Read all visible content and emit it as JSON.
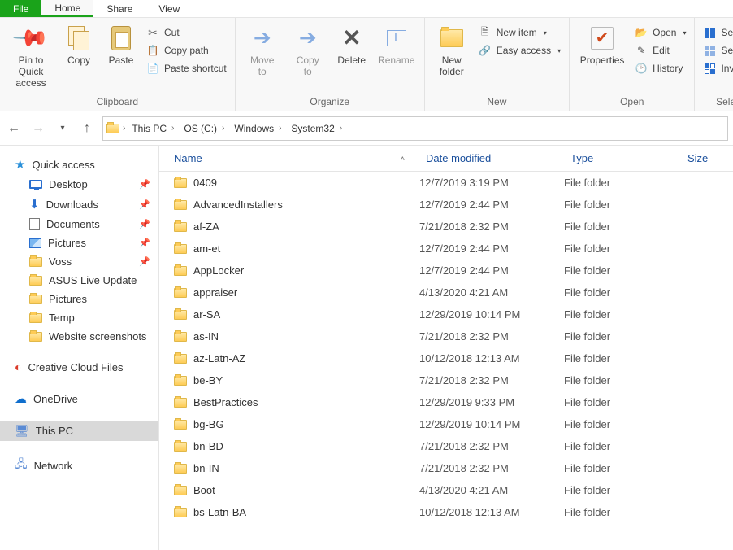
{
  "tabs": {
    "file": "File",
    "home": "Home",
    "share": "Share",
    "view": "View"
  },
  "ribbon": {
    "clipboard": {
      "label": "Clipboard",
      "pin": "Pin to Quick\naccess",
      "copy": "Copy",
      "paste": "Paste",
      "cut": "Cut",
      "copypath": "Copy path",
      "pasteshortcut": "Paste shortcut"
    },
    "organize": {
      "label": "Organize",
      "moveto": "Move\nto",
      "copyto": "Copy\nto",
      "delete": "Delete",
      "rename": "Rename"
    },
    "new": {
      "label": "New",
      "newfolder": "New\nfolder",
      "newitem": "New item",
      "easyaccess": "Easy access"
    },
    "open": {
      "label": "Open",
      "properties": "Properties",
      "open": "Open",
      "edit": "Edit",
      "history": "History"
    },
    "select": {
      "label": "Sele",
      "all": "Select",
      "none": "Select",
      "invert": "Invert"
    }
  },
  "breadcrumbs": [
    "This PC",
    "OS (C:)",
    "Windows",
    "System32"
  ],
  "columns": {
    "name": "Name",
    "date": "Date modified",
    "type": "Type",
    "size": "Size"
  },
  "sidebar": {
    "quick": "Quick access",
    "items": [
      {
        "icon": "monitor",
        "label": "Desktop",
        "pin": true
      },
      {
        "icon": "down",
        "label": "Downloads",
        "pin": true
      },
      {
        "icon": "doc",
        "label": "Documents",
        "pin": true
      },
      {
        "icon": "pic",
        "label": "Pictures",
        "pin": true
      },
      {
        "icon": "folder",
        "label": "Voss",
        "pin": true
      },
      {
        "icon": "folder",
        "label": "ASUS Live Update",
        "pin": false
      },
      {
        "icon": "folder",
        "label": "Pictures",
        "pin": false
      },
      {
        "icon": "folder",
        "label": "Temp",
        "pin": false
      },
      {
        "icon": "folder",
        "label": "Website screenshots",
        "pin": false
      }
    ],
    "creative": "Creative Cloud Files",
    "onedrive": "OneDrive",
    "thispc": "This PC",
    "network": "Network"
  },
  "files": [
    {
      "name": "0409",
      "date": "12/7/2019 3:19 PM",
      "type": "File folder"
    },
    {
      "name": "AdvancedInstallers",
      "date": "12/7/2019 2:44 PM",
      "type": "File folder"
    },
    {
      "name": "af-ZA",
      "date": "7/21/2018 2:32 PM",
      "type": "File folder"
    },
    {
      "name": "am-et",
      "date": "12/7/2019 2:44 PM",
      "type": "File folder"
    },
    {
      "name": "AppLocker",
      "date": "12/7/2019 2:44 PM",
      "type": "File folder"
    },
    {
      "name": "appraiser",
      "date": "4/13/2020 4:21 AM",
      "type": "File folder"
    },
    {
      "name": "ar-SA",
      "date": "12/29/2019 10:14 PM",
      "type": "File folder"
    },
    {
      "name": "as-IN",
      "date": "7/21/2018 2:32 PM",
      "type": "File folder"
    },
    {
      "name": "az-Latn-AZ",
      "date": "10/12/2018 12:13 AM",
      "type": "File folder"
    },
    {
      "name": "be-BY",
      "date": "7/21/2018 2:32 PM",
      "type": "File folder"
    },
    {
      "name": "BestPractices",
      "date": "12/29/2019 9:33 PM",
      "type": "File folder"
    },
    {
      "name": "bg-BG",
      "date": "12/29/2019 10:14 PM",
      "type": "File folder"
    },
    {
      "name": "bn-BD",
      "date": "7/21/2018 2:32 PM",
      "type": "File folder"
    },
    {
      "name": "bn-IN",
      "date": "7/21/2018 2:32 PM",
      "type": "File folder"
    },
    {
      "name": "Boot",
      "date": "4/13/2020 4:21 AM",
      "type": "File folder"
    },
    {
      "name": "bs-Latn-BA",
      "date": "10/12/2018 12:13 AM",
      "type": "File folder"
    }
  ]
}
